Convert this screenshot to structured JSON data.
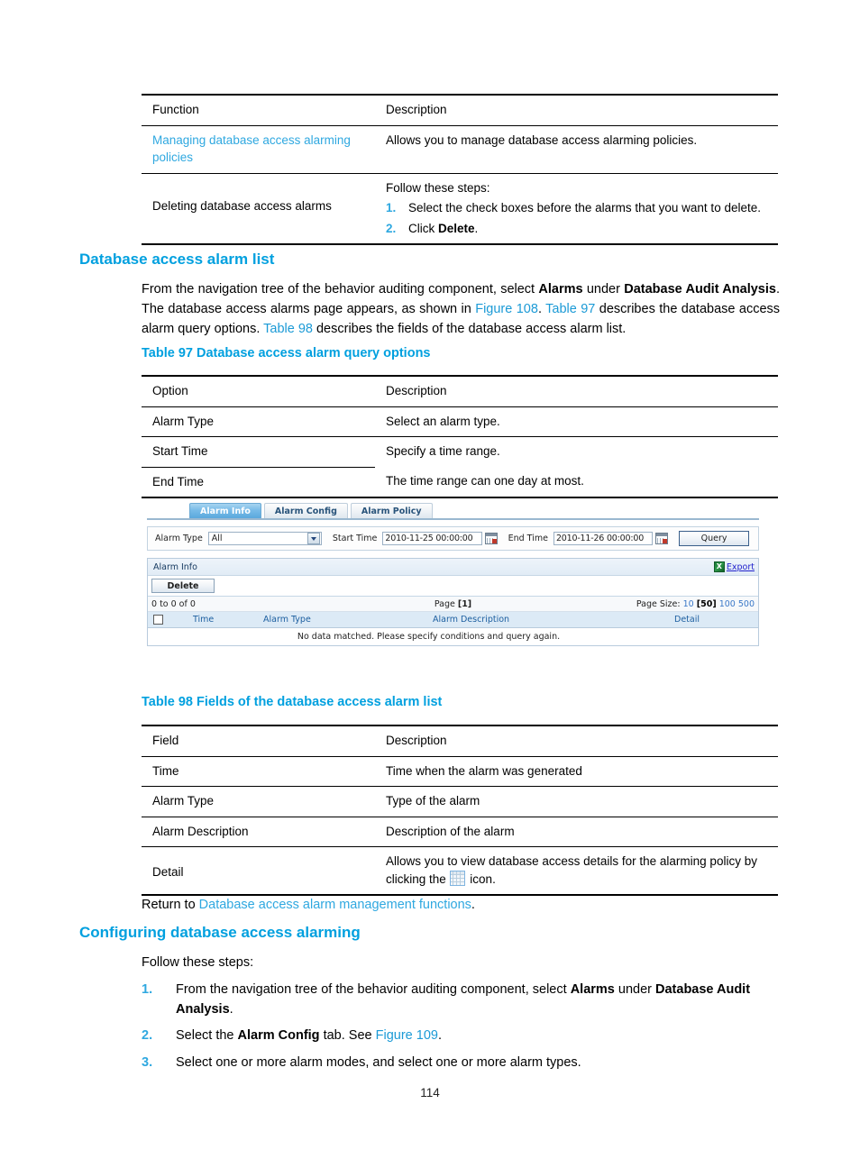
{
  "table96": {
    "headers": [
      "Function",
      "Description"
    ],
    "rows": [
      {
        "function": "Managing database access alarming policies",
        "function_is_link": true,
        "description": "Allows you to manage database access alarming policies."
      },
      {
        "function": "Deleting database access alarms",
        "function_is_link": false,
        "description_intro": "Follow these steps:",
        "steps": [
          {
            "num": "1.",
            "pre": "Select the check boxes before the alarms that you want to delete.",
            "bold": "",
            "post": ""
          },
          {
            "num": "2.",
            "pre": "Click ",
            "bold": "Delete",
            "post": "."
          }
        ]
      }
    ]
  },
  "section1": {
    "heading": "Database access alarm list",
    "para": {
      "p1": "From the navigation tree of the behavior auditing component, select ",
      "b1": "Alarms",
      "p2": " under ",
      "b2": "Database Audit Analysis",
      "p3": ". The database access alarms page appears, as shown in ",
      "l1": "Figure 108",
      "p4": ". ",
      "l2": "Table 97",
      "p5": " describes the database access alarm query options. ",
      "l3": "Table 98",
      "p6": " describes the fields of the database access alarm list."
    }
  },
  "table97": {
    "caption": "Table 97 Database access alarm query options",
    "headers": [
      "Option",
      "Description"
    ],
    "rows": [
      {
        "option": "Alarm Type",
        "description": "Select an alarm type."
      },
      {
        "option": "Start Time",
        "description": "Specify a time range."
      },
      {
        "option": "End Time",
        "description": "The time range can one day at most."
      }
    ]
  },
  "screenshot": {
    "tabs": [
      {
        "label": "Alarm Info",
        "active": true
      },
      {
        "label": "Alarm Config",
        "active": false
      },
      {
        "label": "Alarm Policy",
        "active": false
      }
    ],
    "query_bar": {
      "alarm_type_label": "Alarm Type",
      "alarm_type_value": "All",
      "start_time_label": "Start Time",
      "start_time_value": "2010-11-25 00:00:00",
      "end_time_label": "End Time",
      "end_time_value": "2010-11-26 00:00:00",
      "query_button": "Query"
    },
    "panel": {
      "title": "Alarm Info",
      "export_label": "Export",
      "delete_button": "Delete",
      "range_text": "0 to 0 of 0",
      "page_label": "Page",
      "page_current": "[1]",
      "page_size_label": "Page Size:",
      "page_sizes": [
        "10",
        "50",
        "100",
        "500"
      ],
      "page_size_current": "50",
      "columns": [
        "Time",
        "Alarm Type",
        "Alarm Description",
        "Detail"
      ],
      "empty_message": "No data matched. Please specify conditions and query again."
    }
  },
  "table98": {
    "caption": "Table 98 Fields of the database access alarm list",
    "headers": [
      "Field",
      "Description"
    ],
    "rows": [
      {
        "field": "Time",
        "description": "Time when the alarm was generated"
      },
      {
        "field": "Alarm Type",
        "description": "Type of the alarm"
      },
      {
        "field": "Alarm Description",
        "description": "Description of the alarm"
      },
      {
        "field": "Detail",
        "description_pre": "Allows you to view database access details for the alarming policy by clicking the ",
        "description_post": " icon."
      }
    ]
  },
  "return_line": {
    "pre": "Return to ",
    "link": "Database access alarm management functions",
    "post": "."
  },
  "section2": {
    "heading": "Configuring database access alarming",
    "intro": "Follow these steps:",
    "steps": [
      {
        "num": "1.",
        "p1": "From the navigation tree of the behavior auditing component, select ",
        "b1": "Alarms",
        "p2": " under ",
        "b2": "Database Audit Analysis",
        "p3": "."
      },
      {
        "num": "2.",
        "p1": "Select the ",
        "b1": "Alarm Config",
        "p2": " tab. See ",
        "l1": "Figure 109",
        "p3": "."
      },
      {
        "num": "3.",
        "p1": "Select one or more alarm modes, and select one or more alarm types.",
        "b1": "",
        "p2": "",
        "p3": ""
      }
    ]
  },
  "footer": {
    "page_number": "114"
  }
}
